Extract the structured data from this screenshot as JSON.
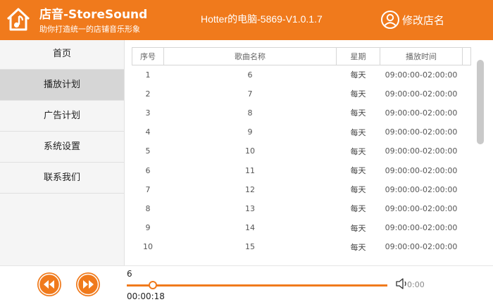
{
  "header": {
    "brand_title": "店音-StoreSound",
    "brand_subtitle": "助你打造统一的店铺音乐形象",
    "window_title": "Hotter的电脑-5869-V1.0.1.7",
    "rename_label": "修改店名"
  },
  "sidebar": {
    "items": [
      {
        "label": "首页"
      },
      {
        "label": "播放计划"
      },
      {
        "label": "广告计划"
      },
      {
        "label": "系统设置"
      },
      {
        "label": "联系我们"
      }
    ],
    "active_index": 1
  },
  "table": {
    "headers": [
      "序号",
      "歌曲名称",
      "星期",
      "播放时间"
    ],
    "rows": [
      [
        "1",
        "6",
        "每天",
        "09:00:00-02:00:00"
      ],
      [
        "2",
        "7",
        "每天",
        "09:00:00-02:00:00"
      ],
      [
        "3",
        "8",
        "每天",
        "09:00:00-02:00:00"
      ],
      [
        "4",
        "9",
        "每天",
        "09:00:00-02:00:00"
      ],
      [
        "5",
        "10",
        "每天",
        "09:00:00-02:00:00"
      ],
      [
        "6",
        "11",
        "每天",
        "09:00:00-02:00:00"
      ],
      [
        "7",
        "12",
        "每天",
        "09:00:00-02:00:00"
      ],
      [
        "8",
        "13",
        "每天",
        "09:00:00-02:00:00"
      ],
      [
        "9",
        "14",
        "每天",
        "09:00:00-02:00:00"
      ],
      [
        "10",
        "15",
        "每天",
        "09:00:00-02:00:00"
      ]
    ]
  },
  "player": {
    "track": "6",
    "current_time": "00:00:18",
    "progress_fraction": 0.1,
    "partial_text": "0:00"
  },
  "colors": {
    "accent": "#f07a1c",
    "sidebar_bg": "#f5f5f5",
    "sidebar_active": "#d6d6d6"
  },
  "icons": {
    "logo": "house-music-note-icon",
    "user": "user-circle-icon",
    "prev": "rewind-icon",
    "next": "fast-forward-icon",
    "volume": "speaker-icon"
  }
}
